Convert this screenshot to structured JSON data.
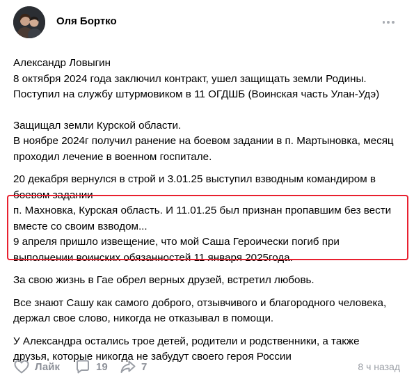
{
  "post": {
    "author": "Оля Бортко",
    "paragraphs_top": [
      "Александр Ловыгин",
      "8 октября 2024 года заключил контракт, ушел защищать земли Родины.",
      "Поступил на службу штурмовиком в 11 ОГДШБ (Воинская часть Улан-Удэ)"
    ],
    "paragraph_2": [
      "Защищал земли Курской области.",
      "В ноябре 2024г получил ранение на боевом задании в п. Мартыновка, месяц",
      "проходил лечение в военном госпитале."
    ],
    "paragraph_3": [
      "20 декабря вернулся в строй и 3.01.25 выступил взводным командиром в",
      "боевом задании",
      "п. Махновка, Курская область. И 11.01.25 был признан пропавшим без вести",
      "вместе со своим взводом...",
      "9 апреля пришло извещение, что мой Саша Героически погиб при",
      "выполнении воинских обязанностей 11 января 2025года."
    ],
    "paragraph_4": "За свою жизнь в Гае обрел верных друзей, встретил любовь.",
    "paragraph_5": [
      "Все знают Сашу как самого доброго, отзывчивого и благородного человека,",
      "держал свое слово, никогда не отказывал в помощи."
    ],
    "paragraph_6": [
      "У Александра остались трое детей, родители и родственники, а также",
      "друзья, которые никогда не забудут своего героя России"
    ]
  },
  "footer": {
    "like_label": "Лайк",
    "comments_count": "19",
    "shares_count": "7",
    "time": "8 ч назад"
  },
  "icons": {
    "like": "heart-icon",
    "comment": "comment-icon",
    "share": "share-icon",
    "more": "more-icon"
  },
  "colors": {
    "highlight_border": "#e8202f",
    "muted": "#8d9199"
  }
}
